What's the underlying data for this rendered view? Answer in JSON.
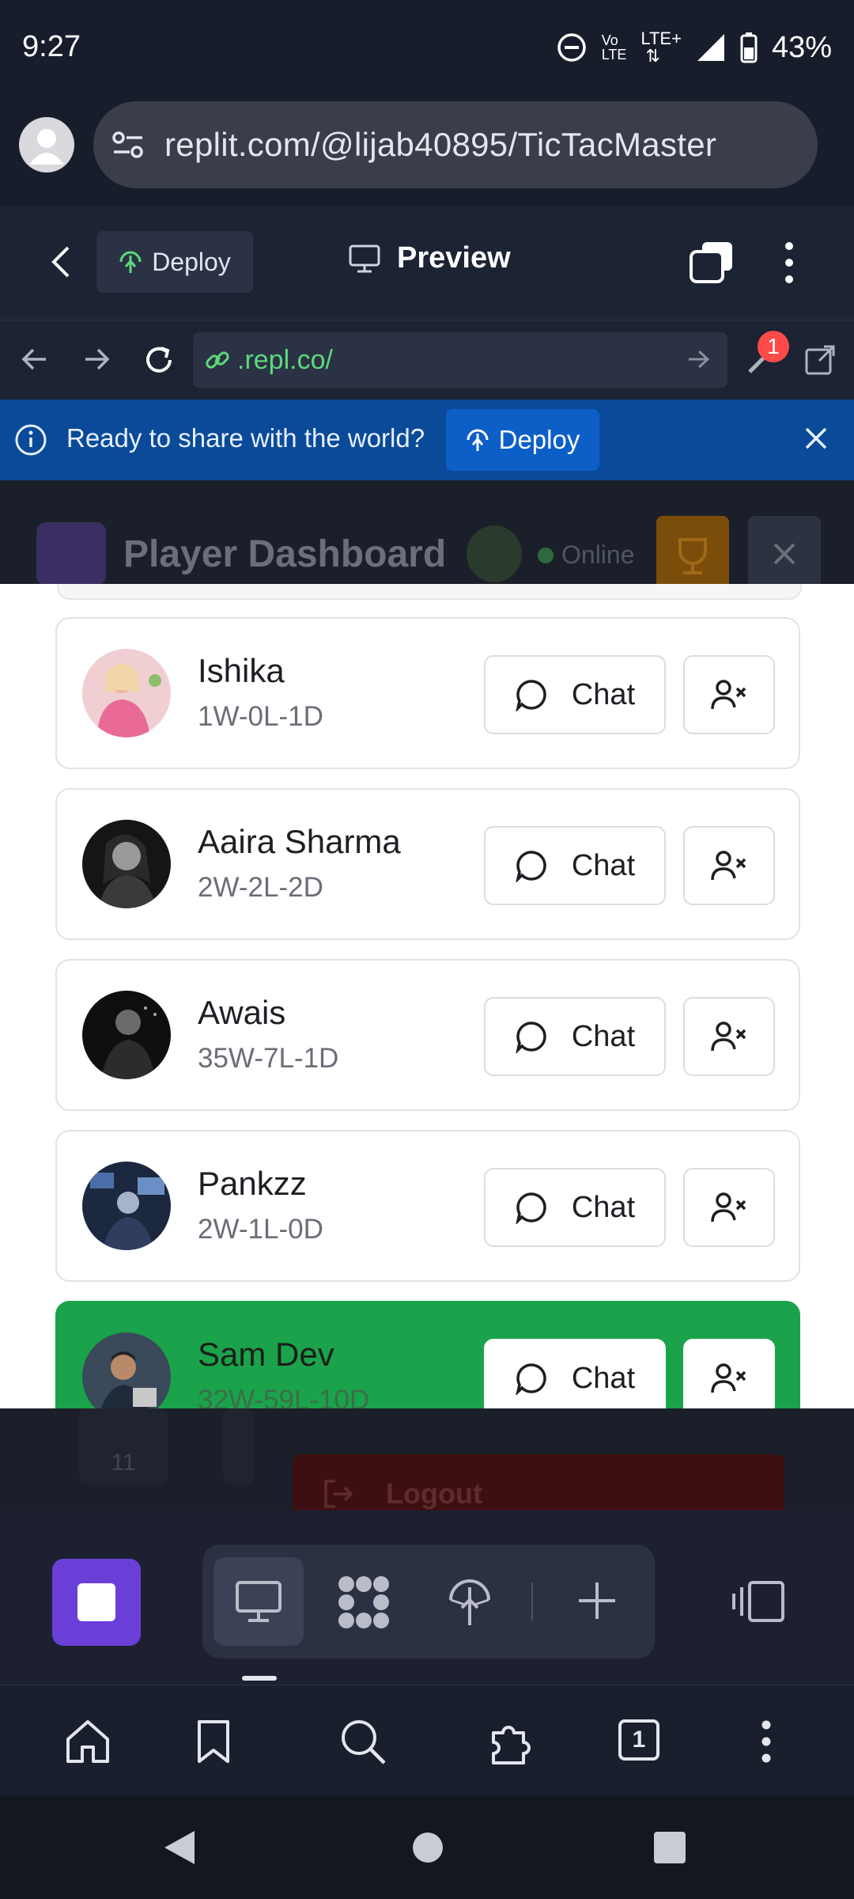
{
  "status_bar": {
    "time": "9:27",
    "battery": "43%"
  },
  "browser": {
    "url": "replit.com/@lijab40895/TicTacMaster"
  },
  "replit_toolbar": {
    "deploy_label": "Deploy",
    "preview_label": "Preview"
  },
  "webview": {
    "address": ".repl.co/",
    "notifications": "1"
  },
  "banner": {
    "message": "Ready to share with the world?",
    "deploy_label": "Deploy"
  },
  "dashboard": {
    "title": "Player Dashboard",
    "status": "Online",
    "logout_label": "Logout",
    "card_value": "11"
  },
  "friends": [
    {
      "name": "Ishika",
      "record": "1W-0L-1D",
      "chat_label": "Chat"
    },
    {
      "name": "Aaira Sharma",
      "record": "2W-2L-2D",
      "chat_label": "Chat"
    },
    {
      "name": "Awais",
      "record": "35W-7L-1D",
      "chat_label": "Chat"
    },
    {
      "name": "Pankzz",
      "record": "2W-1L-0D",
      "chat_label": "Chat"
    },
    {
      "name": "Sam Dev",
      "record": "32W-59L-10D",
      "chat_label": "Chat",
      "highlighted": true
    }
  ],
  "browser_bottom": {
    "tab_count": "1"
  },
  "colors": {
    "highlight": "#1aa34a",
    "deploy_banner": "#0a4a99",
    "stop_button": "#6a3fd8"
  },
  "icons": [
    "info-icon",
    "deploy-icon",
    "monitor-icon",
    "chat-icon",
    "remove-friend-icon",
    "home-icon",
    "bookmark-icon",
    "search-icon",
    "extensions-icon",
    "tabs-icon",
    "menu-icon"
  ]
}
